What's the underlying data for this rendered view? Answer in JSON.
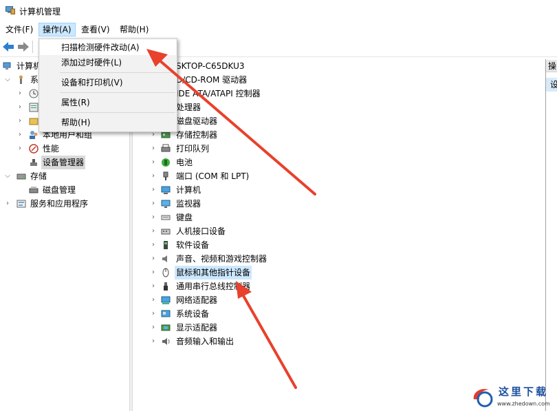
{
  "window": {
    "title": "计算机管理"
  },
  "menubar": [
    {
      "label": "文件(F)"
    },
    {
      "label": "操作(A)"
    },
    {
      "label": "查看(V)"
    },
    {
      "label": "帮助(H)"
    }
  ],
  "dropdown": {
    "items": [
      {
        "label": "扫描检测硬件改动(A)"
      },
      {
        "label": "添加过时硬件(L)"
      },
      {
        "label": "设备和打印机(V)"
      },
      {
        "label": "属性(R)"
      },
      {
        "label": "帮助(H)"
      }
    ]
  },
  "left_tree": {
    "root_partial": "计算机",
    "system_tools_partial": "系",
    "local_users_partial": "本地用户和组",
    "performance": "性能",
    "device_manager": "设备管理器",
    "storage": "存储",
    "disk_management": "磁盘管理",
    "services": "服务和应用程序"
  },
  "device_tree": {
    "computer_name_partial": "SKTOP-C65DKU3",
    "dvd_partial": "D/CD-ROM 驱动器",
    "ide_partial": "IDE ATA/ATAPI 控制器",
    "processor_partial": "处理器",
    "categories": [
      {
        "label": "磁盘驱动器",
        "icon": "disk-drive-icon"
      },
      {
        "label": "存储控制器",
        "icon": "storage-controller-icon"
      },
      {
        "label": "打印队列",
        "icon": "printer-icon"
      },
      {
        "label": "电池",
        "icon": "battery-icon"
      },
      {
        "label": "端口 (COM 和 LPT)",
        "icon": "port-icon"
      },
      {
        "label": "计算机",
        "icon": "computer-icon"
      },
      {
        "label": "监视器",
        "icon": "monitor-icon"
      },
      {
        "label": "键盘",
        "icon": "keyboard-icon"
      },
      {
        "label": "人机接口设备",
        "icon": "hid-icon"
      },
      {
        "label": "软件设备",
        "icon": "software-device-icon"
      },
      {
        "label": "声音、视频和游戏控制器",
        "icon": "sound-icon"
      },
      {
        "label": "鼠标和其他指针设备",
        "icon": "mouse-icon"
      },
      {
        "label": "通用串行总线控制器",
        "icon": "usb-icon"
      },
      {
        "label": "网络适配器",
        "icon": "network-adapter-icon"
      },
      {
        "label": "系统设备",
        "icon": "system-device-icon"
      },
      {
        "label": "显示适配器",
        "icon": "display-adapter-icon"
      },
      {
        "label": "音频输入和输出",
        "icon": "audio-io-icon"
      }
    ]
  },
  "actions_pane": {
    "header_partial": "操",
    "item_partial": "设"
  },
  "watermark": {
    "title": "这里下载",
    "url": "www.zhedown.com"
  },
  "colors": {
    "menu_highlight": "#cce8ff",
    "selection": "#d9d9d9",
    "annotation_arrow": "#e8412c"
  }
}
